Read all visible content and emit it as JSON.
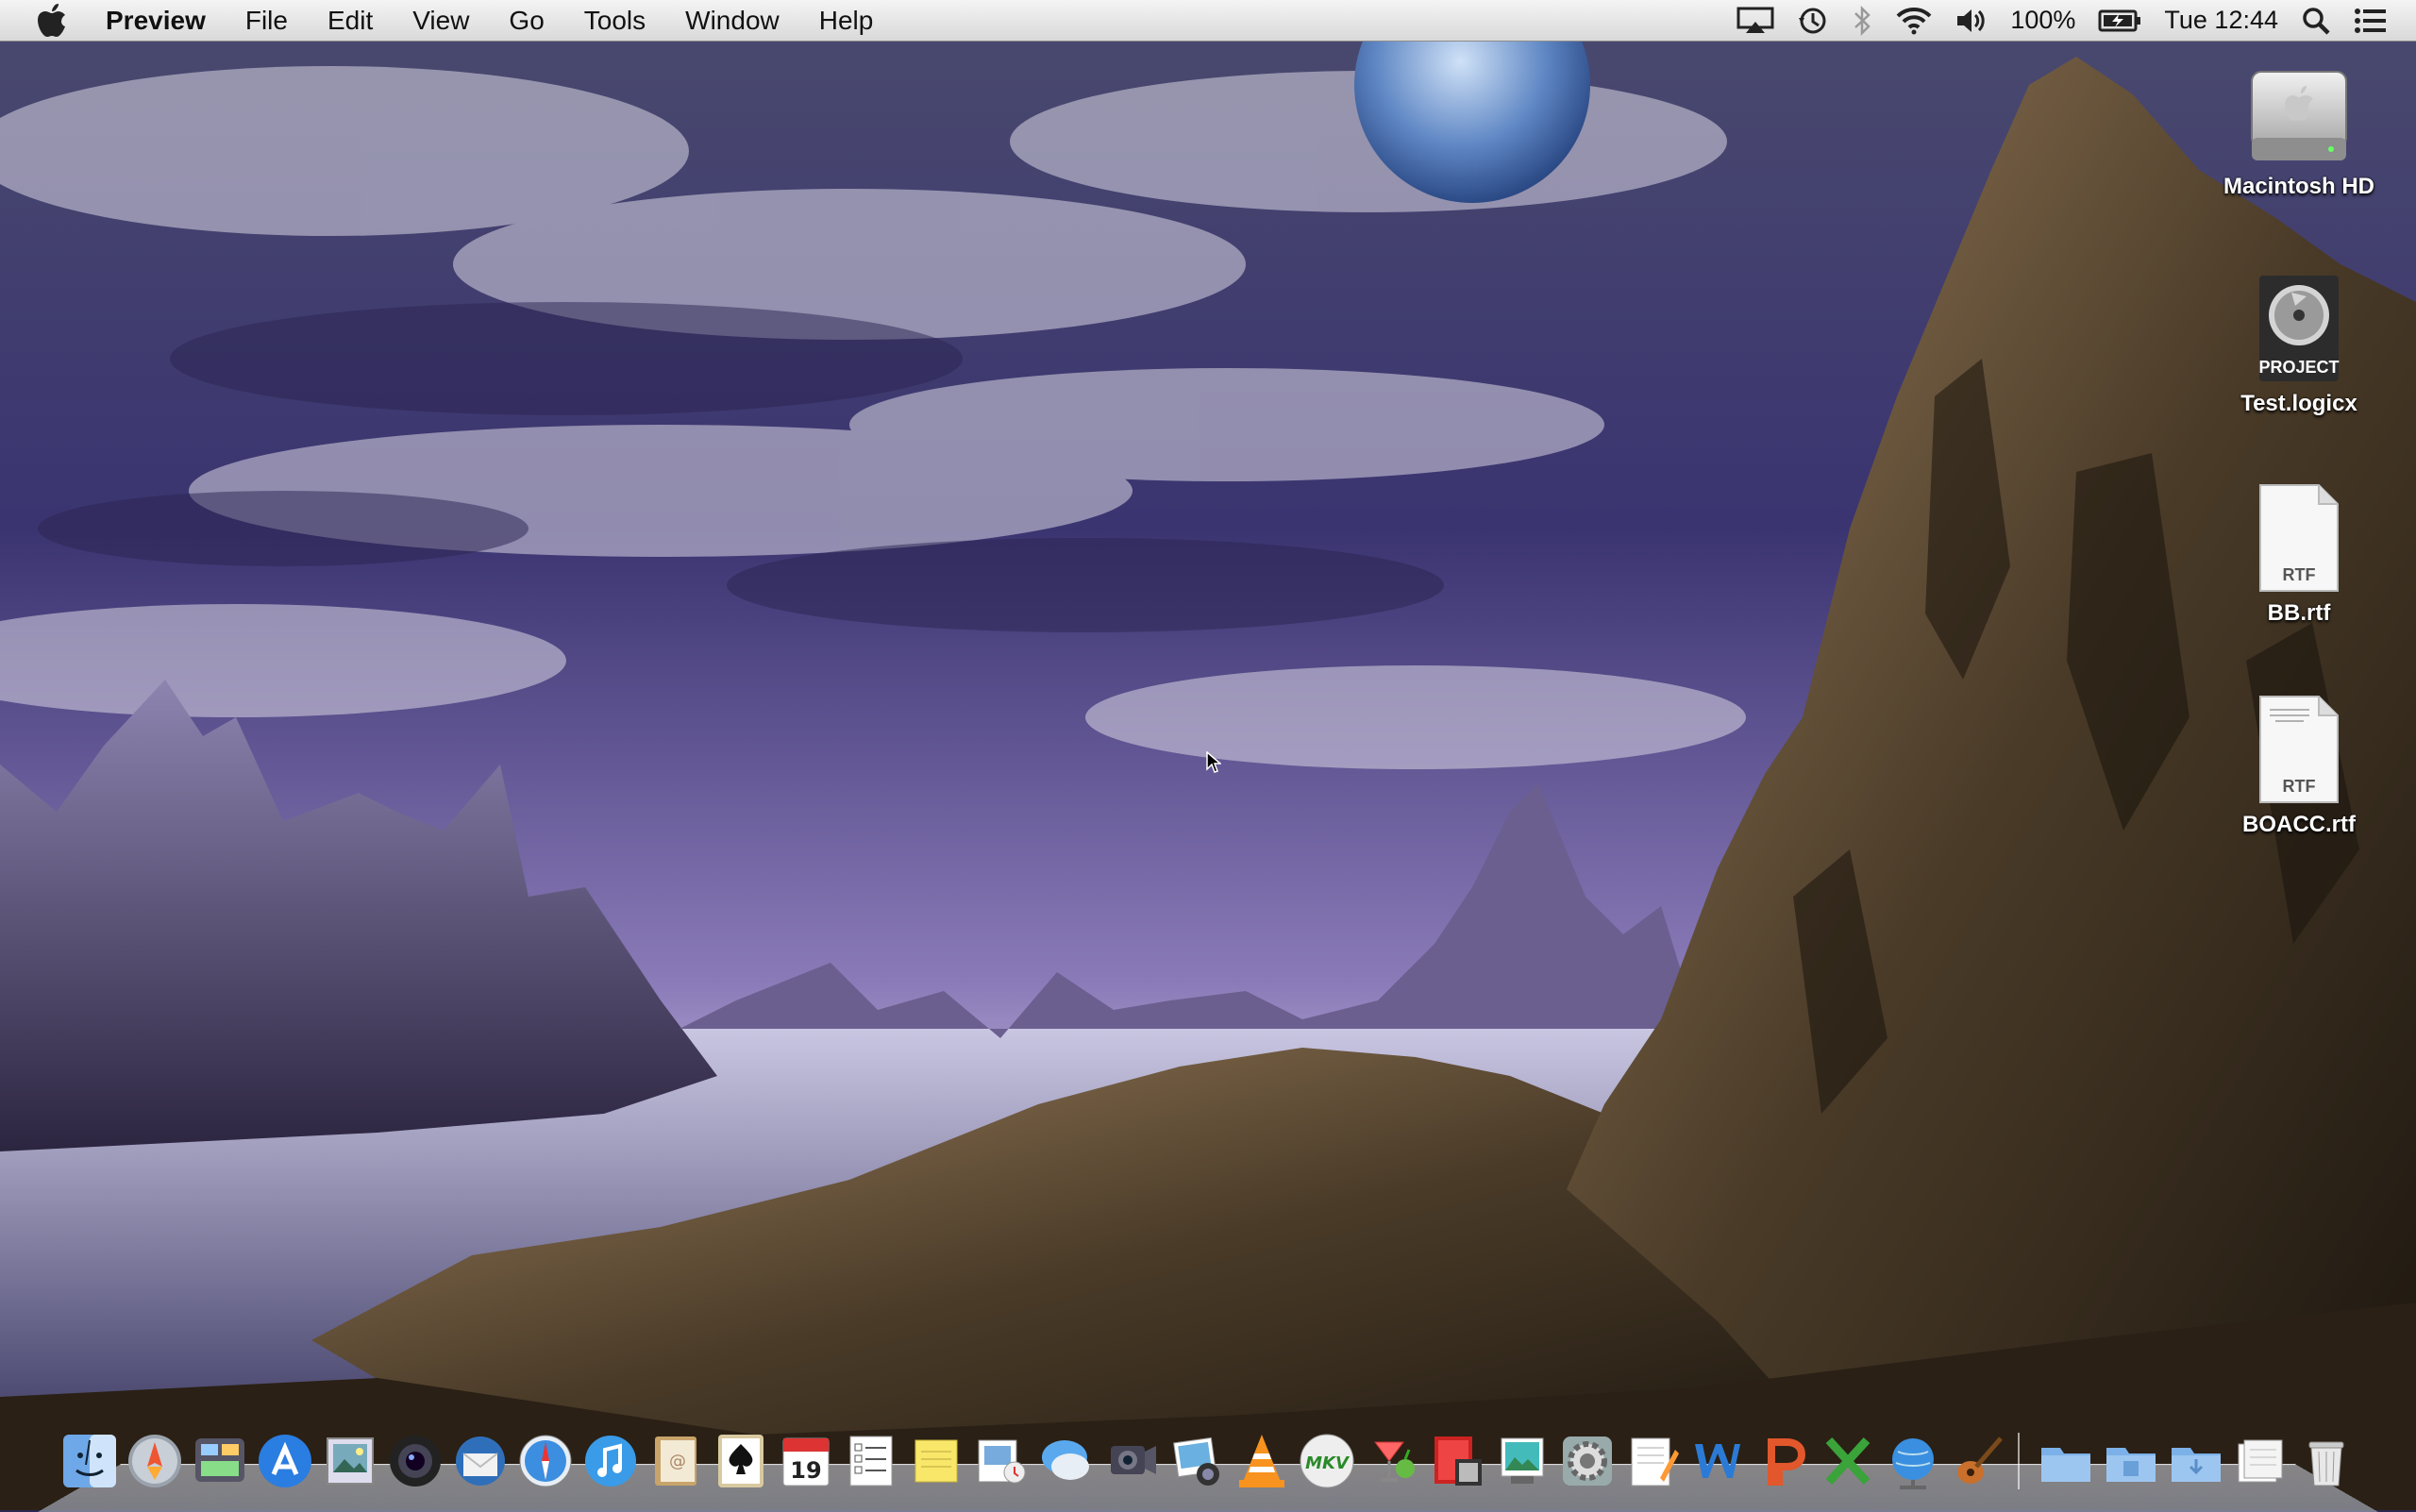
{
  "menubar": {
    "app_name": "Preview",
    "menus": [
      "File",
      "Edit",
      "View",
      "Go",
      "Tools",
      "Window",
      "Help"
    ],
    "battery": "100%",
    "clock": "Tue 12:44",
    "status_icons": [
      "airplay-icon",
      "time-machine-icon",
      "bluetooth-icon",
      "wifi-icon",
      "volume-icon",
      "battery-icon",
      "spotlight-icon",
      "notification-center-icon"
    ]
  },
  "desktop": {
    "icons": [
      {
        "label": "Macintosh HD",
        "type": "hard-drive"
      },
      {
        "label": "Test.logicx",
        "type": "logic-project",
        "badge": "PROJECT"
      },
      {
        "label": "BB.rtf",
        "type": "rtf-document",
        "badge": "RTF"
      },
      {
        "label": "BOACC.rtf",
        "type": "rtf-document",
        "badge": "RTF"
      }
    ]
  },
  "dock": {
    "apps": [
      "finder",
      "launchpad",
      "mission-control",
      "app-store",
      "preview",
      "facetime-camera",
      "thunderbird",
      "safari",
      "itunes",
      "contacts",
      "solitaire",
      "calendar",
      "reminders",
      "stickies",
      "preview-docs",
      "messages",
      "photo-booth",
      "iphoto",
      "vlc",
      "mkv-player",
      "cocktail",
      "photo-slideshow",
      "image-capture",
      "system-preferences",
      "textedit",
      "word",
      "powerpoint",
      "excel",
      "network-utility",
      "garageband"
    ],
    "calendar_day": "19",
    "mkv_label": "MKV",
    "stacks": [
      "applications-stack",
      "documents-stack",
      "downloads-stack",
      "recent-docs-stack",
      "trash"
    ]
  }
}
